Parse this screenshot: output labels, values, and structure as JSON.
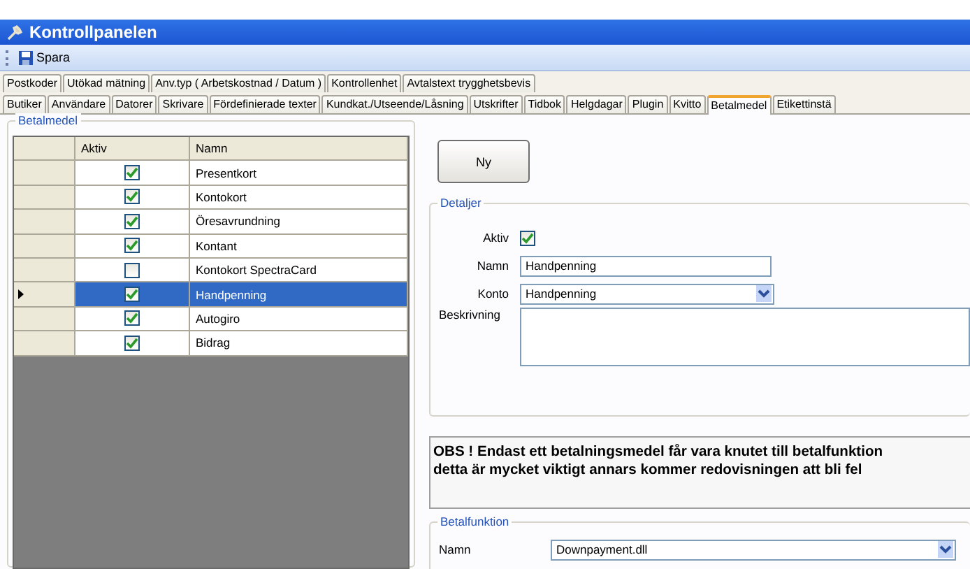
{
  "window": {
    "title": "Kontrollpanelen"
  },
  "toolbar": {
    "save_label": "Spara"
  },
  "tab_rows": [
    [
      {
        "label": "Postkoder",
        "selected": false
      },
      {
        "label": "Utökad mätning",
        "selected": false
      },
      {
        "label": "Anv.typ ( Arbetskostnad / Datum )",
        "selected": false
      },
      {
        "label": "Kontrollenhet",
        "selected": false
      },
      {
        "label": "Avtalstext trygghetsbevis",
        "selected": false
      }
    ],
    [
      {
        "label": "Butiker",
        "selected": false
      },
      {
        "label": "Användare",
        "selected": false
      },
      {
        "label": "Datorer",
        "selected": false
      },
      {
        "label": "Skrivare",
        "selected": false
      },
      {
        "label": "Fördefinierade texter",
        "selected": false
      },
      {
        "label": "Kundkat./Utseende/Låsning",
        "selected": false
      },
      {
        "label": "Utskrifter",
        "selected": false
      },
      {
        "label": "Tidbok",
        "selected": false
      },
      {
        "label": "Helgdagar",
        "selected": false
      },
      {
        "label": "Plugin",
        "selected": false
      },
      {
        "label": "Kvitto",
        "selected": false
      },
      {
        "label": "Betalmedel",
        "selected": true
      },
      {
        "label": "Etikettinstä",
        "selected": false
      }
    ]
  ],
  "list_group": {
    "title": "Betalmedel",
    "columns": [
      "Aktiv",
      "Namn"
    ],
    "rows": [
      {
        "active": true,
        "name": "Presentkort",
        "selected": false
      },
      {
        "active": true,
        "name": "Kontokort",
        "selected": false
      },
      {
        "active": true,
        "name": "Öresavrundning",
        "selected": false
      },
      {
        "active": true,
        "name": "Kontant",
        "selected": false
      },
      {
        "active": false,
        "name": "Kontokort SpectraCard",
        "selected": false
      },
      {
        "active": true,
        "name": "Handpenning",
        "selected": true
      },
      {
        "active": true,
        "name": "Autogiro",
        "selected": false
      },
      {
        "active": true,
        "name": "Bidrag",
        "selected": false
      }
    ]
  },
  "new_button": "Ny",
  "details": {
    "title": "Detaljer",
    "active_label": "Aktiv",
    "active": true,
    "name_label": "Namn",
    "name_value": "Handpenning",
    "account_label": "Konto",
    "account_value": "Handpenning",
    "description_label": "Beskrivning"
  },
  "notice": "OBS ! Endast ett betalningsmedel får vara knutet till betalfunktion\ndetta är mycket viktigt annars kommer redovisningen att bli fel",
  "payment_function": {
    "title": "Betalfunktion",
    "name_label": "Namn",
    "name_value": "Downpayment.dll"
  }
}
